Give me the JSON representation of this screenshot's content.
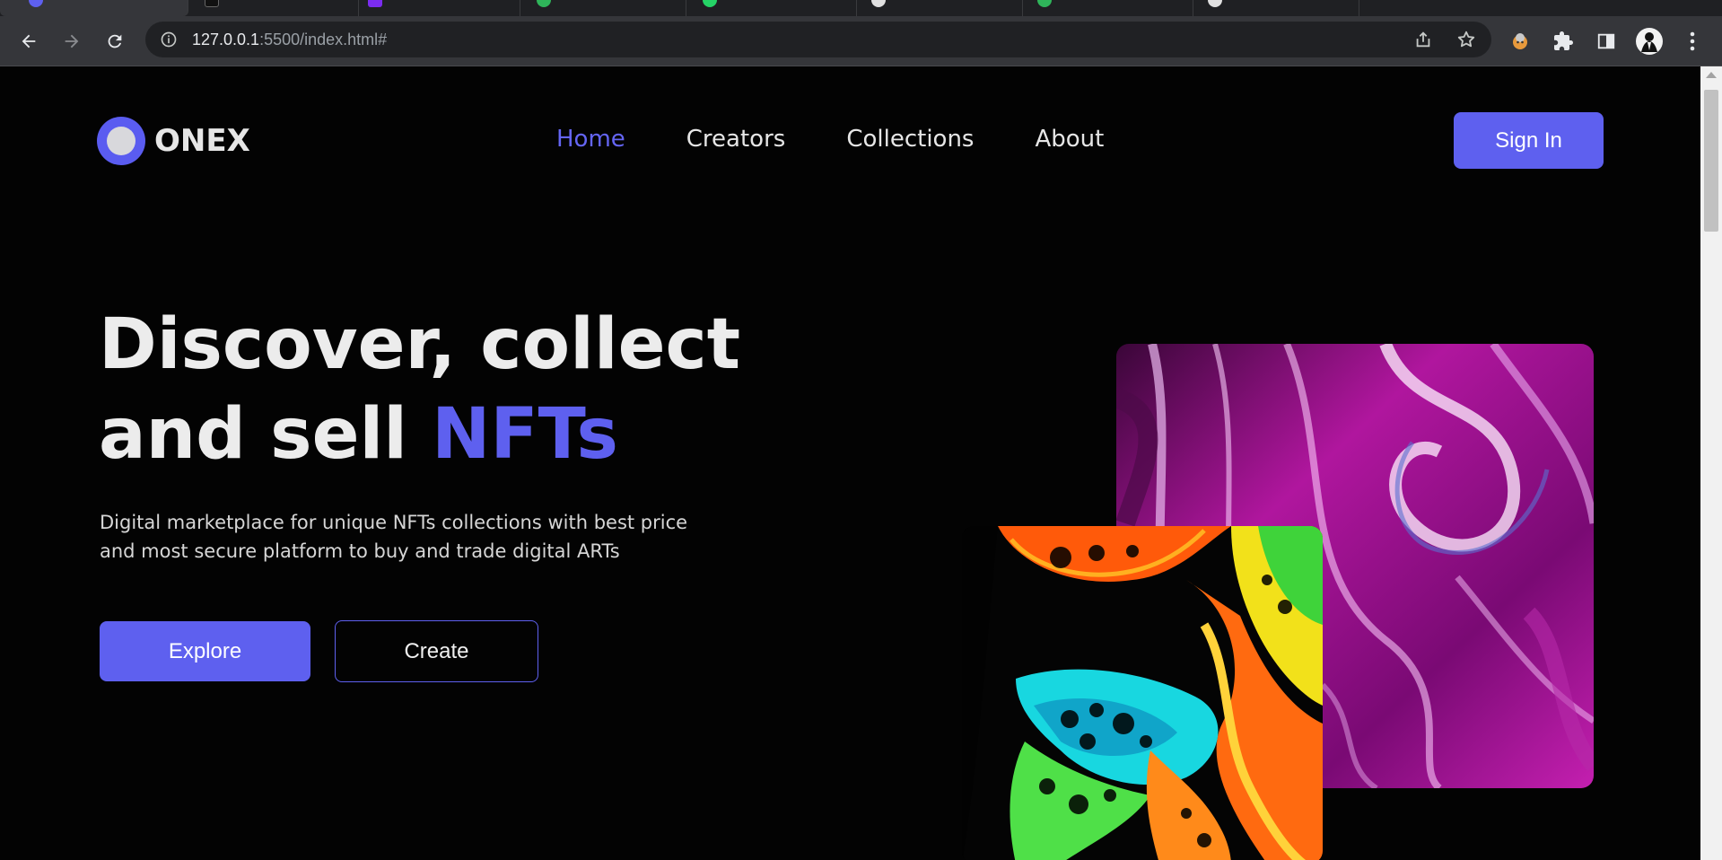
{
  "browser": {
    "address_bar": {
      "url_host": "127.0.0.1",
      "url_rest": ":5500/index.html#"
    },
    "tabs": [
      {
        "favicon_color": "#5e60ef",
        "active": true
      },
      {
        "favicon_color": "#111111"
      },
      {
        "favicon_color": "#7b2cf0"
      },
      {
        "favicon_color": "#2fb55a"
      },
      {
        "favicon_color": "#25d366"
      },
      {
        "favicon_color": "#e0e0e0"
      },
      {
        "favicon_color": "#2fb55a"
      },
      {
        "favicon_color": "#e0e0e0"
      }
    ],
    "icons": [
      "back-icon",
      "forward-icon",
      "reload-icon",
      "site-info-icon",
      "share-icon",
      "bookmark-star-icon",
      "extension-avatar-icon",
      "extensions-puzzle-icon",
      "side-panel-icon",
      "profile-avatar-icon",
      "menu-kebab-icon"
    ]
  },
  "site": {
    "logo_text": "ONEX",
    "nav": {
      "home": "Home",
      "creators": "Creators",
      "collections": "Collections",
      "about": "About"
    },
    "signin_label": "Sign In",
    "hero": {
      "title_line1": "Discover, collect",
      "title_line2_prefix": "and sell ",
      "title_line2_accent": "NFTs",
      "subtitle": "Digital marketplace for unique NFTs collections with best price and most secure platform to buy and trade digital ARTs",
      "explore_label": "Explore",
      "create_label": "Create"
    },
    "colors": {
      "accent": "#5e60ef",
      "background": "#030303",
      "text": "#e8e8e8"
    }
  }
}
